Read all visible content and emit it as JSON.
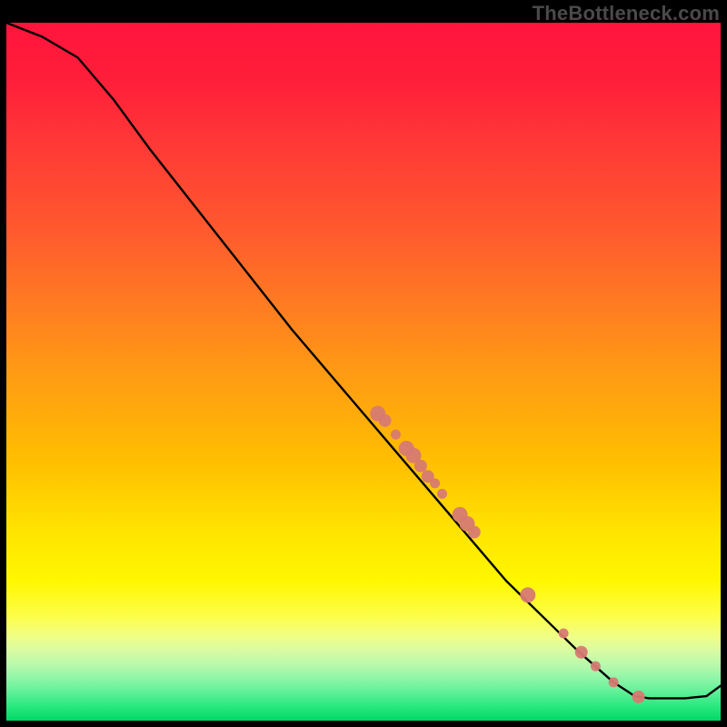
{
  "watermark": "TheBottleneck.com",
  "colors": {
    "dot": "#d77a72",
    "curve": "#000000"
  },
  "chart_data": {
    "type": "line",
    "title": "",
    "xlabel": "",
    "ylabel": "",
    "xlim": [
      0,
      100
    ],
    "ylim": [
      0,
      100
    ],
    "note": "Axes are implicit (no tick labels in source). Values are estimated on a 0-100 normalized scale where (0,0) is bottom-left of the colored plot area.",
    "curve": [
      {
        "x": 0,
        "y": 100
      },
      {
        "x": 5,
        "y": 98
      },
      {
        "x": 10,
        "y": 95
      },
      {
        "x": 15,
        "y": 89
      },
      {
        "x": 20,
        "y": 82
      },
      {
        "x": 30,
        "y": 69
      },
      {
        "x": 40,
        "y": 56
      },
      {
        "x": 50,
        "y": 44
      },
      {
        "x": 55,
        "y": 38
      },
      {
        "x": 60,
        "y": 32
      },
      {
        "x": 65,
        "y": 26
      },
      {
        "x": 70,
        "y": 20
      },
      {
        "x": 75,
        "y": 15
      },
      {
        "x": 80,
        "y": 10
      },
      {
        "x": 85,
        "y": 5.5
      },
      {
        "x": 88,
        "y": 3.5
      },
      {
        "x": 90,
        "y": 3.2
      },
      {
        "x": 95,
        "y": 3.2
      },
      {
        "x": 98,
        "y": 3.5
      },
      {
        "x": 100,
        "y": 5
      }
    ],
    "scatter_points": [
      {
        "x": 52,
        "y": 44,
        "size": "big"
      },
      {
        "x": 53,
        "y": 43,
        "size": "med"
      },
      {
        "x": 54.5,
        "y": 41,
        "size": "sm"
      },
      {
        "x": 56,
        "y": 39,
        "size": "big"
      },
      {
        "x": 57,
        "y": 38,
        "size": "big"
      },
      {
        "x": 58,
        "y": 36.5,
        "size": "med"
      },
      {
        "x": 59,
        "y": 35,
        "size": "med"
      },
      {
        "x": 60,
        "y": 34,
        "size": "sm"
      },
      {
        "x": 61,
        "y": 32.5,
        "size": "sm"
      },
      {
        "x": 63.5,
        "y": 29.5,
        "size": "big"
      },
      {
        "x": 64.5,
        "y": 28.2,
        "size": "big"
      },
      {
        "x": 65.5,
        "y": 27,
        "size": "med"
      },
      {
        "x": 73,
        "y": 18,
        "size": "big"
      },
      {
        "x": 78,
        "y": 12.5,
        "size": "sm"
      },
      {
        "x": 80.5,
        "y": 9.8,
        "size": "med"
      },
      {
        "x": 82.5,
        "y": 7.8,
        "size": "sm"
      },
      {
        "x": 85,
        "y": 5.5,
        "size": "sm"
      },
      {
        "x": 88.5,
        "y": 3.4,
        "size": "med"
      }
    ]
  }
}
